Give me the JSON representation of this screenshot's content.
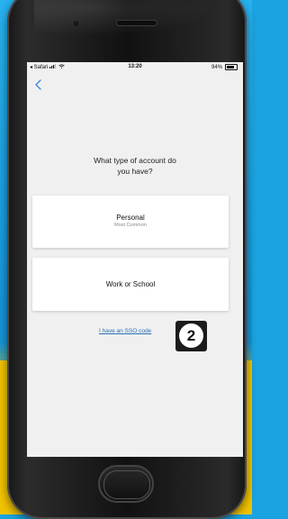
{
  "status_bar": {
    "carrier": "◂ Safari",
    "time": "13:20",
    "battery": "94%"
  },
  "question": {
    "line1": "What type of account do",
    "line2": "you have?"
  },
  "options": {
    "personal": {
      "title": "Personal",
      "subtitle": "Most Common"
    },
    "work": {
      "title": "Work or School"
    }
  },
  "sso_link": "I have an SSO code",
  "step_badge": "2",
  "colors": {
    "link": "#2a6fb5",
    "screen_bg": "#f0f0f0",
    "background_blue": "#1aa3e0",
    "background_yellow": "#f0c300"
  },
  "icons": {
    "back": "chevron-left-icon",
    "signal": "signal-icon",
    "wifi": "wifi-icon",
    "battery": "battery-icon"
  }
}
